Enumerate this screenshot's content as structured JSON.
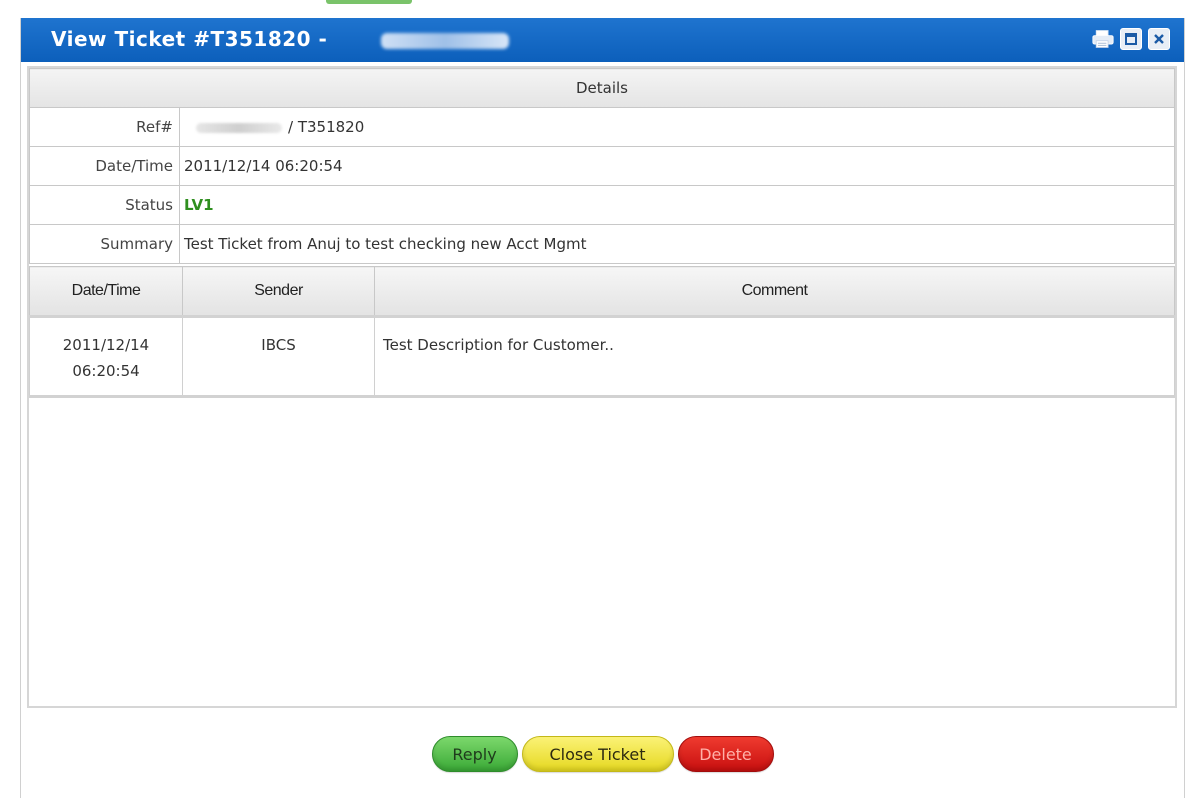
{
  "window": {
    "title": "View Ticket #T351820 -"
  },
  "details": {
    "header": "Details",
    "rows": [
      {
        "label": "Ref#",
        "value": "/ T351820"
      },
      {
        "label": "Date/Time",
        "value": "2011/12/14 06:20:54"
      },
      {
        "label": "Status",
        "value": "LV1"
      },
      {
        "label": "Summary",
        "value": "Test Ticket from Anuj to test checking new Acct Mgmt"
      }
    ]
  },
  "comments": {
    "columns": [
      "Date/Time",
      "Sender",
      "Comment"
    ],
    "rows": [
      {
        "date": "2011/12/14",
        "time": "06:20:54",
        "sender": "IBCS",
        "comment": "Test Description for Customer.."
      }
    ]
  },
  "actions": {
    "reply": "Reply",
    "close_ticket": "Close Ticket",
    "delete": "Delete"
  },
  "icons": {
    "print": "print-icon",
    "maximize": "maximize-icon",
    "close": "close-icon"
  },
  "colors": {
    "titlebar": "#1466c4",
    "status": "#2f8f1f",
    "reply": "#4cbc44",
    "close_ticket": "#f1e43a",
    "delete": "#d81b1b"
  }
}
